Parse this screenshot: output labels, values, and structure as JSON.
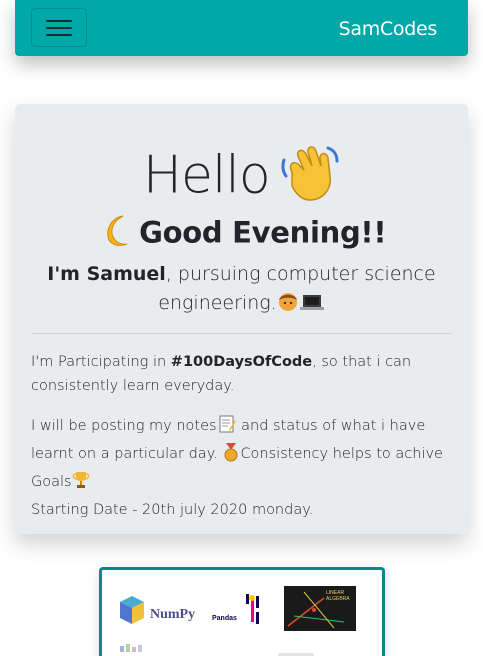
{
  "navbar": {
    "brand": "SamCodes",
    "toggler_icon": "hamburger-menu-icon",
    "bg_color": "#00a8a8"
  },
  "hero": {
    "hello": "Hello",
    "hello_icon": "waving-hand-icon",
    "greeting": "Good Evening!!",
    "greeting_icon": "crescent-moon-icon",
    "intro_name": "I'm Samuel",
    "intro_rest_line1": ", pursuing computer science",
    "intro_rest_line2": "engineering.",
    "intro_icons": [
      "student-icon",
      "laptop-icon"
    ],
    "para1_before": "I'm Participating in ",
    "para1_hashtag": "#100DaysOfCode",
    "para1_after": ", so that i can consistently learn everyday.",
    "para2_part1": "I will be posting my notes",
    "para2_part2": " and status of what i have learnt on a particular day. ",
    "para2_part3": "Consistency helps to achive Goals",
    "para2_part4": "Starting Date - 20th july 2020 monday.",
    "para2_icons": [
      "memo-icon",
      "medal-icon",
      "trophy-icon"
    ]
  },
  "card": {
    "logos": [
      "numpy-logo",
      "pandas-logo",
      "linear-algebra-logo"
    ],
    "numpy_label": "NumPy",
    "pandas_label": "Pandas",
    "linear_algebra_label": "LINEAR ALGEBRA"
  }
}
